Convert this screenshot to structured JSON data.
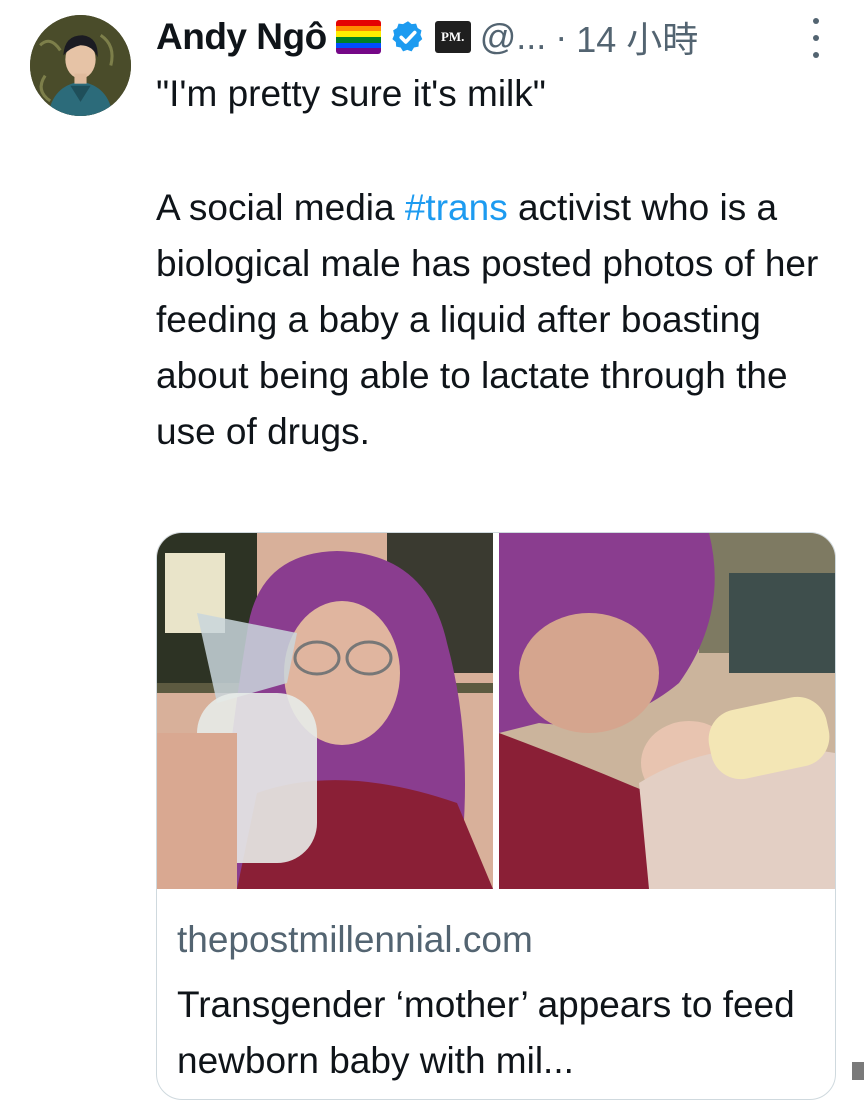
{
  "tweet": {
    "author_name": "Andy Ngô",
    "handle": "@...",
    "separator": "·",
    "time": "14 小時",
    "quote": "\"I'm pretty sure it's milk\"",
    "body_before": "A social media ",
    "hashtag": "#trans",
    "body_after": " activist who is a biological male has posted photos of her feeding a baby a liquid after boasting about being able to lactate through the use of drugs.",
    "badge_logo_text": "PM."
  },
  "icons": {
    "flag": "rainbow-flag-icon",
    "verified": "verified-badge-icon",
    "affiliate": "pm-logo-icon",
    "more": "more-options-icon"
  },
  "link_card": {
    "domain": "thepostmillennial.com",
    "headline": "Transgender ‘mother’ appears to feed newborn baby with mil..."
  },
  "colors": {
    "accent": "#1d9bf0",
    "secondary_text": "#536471",
    "primary_text": "#0f1419",
    "border": "#cfd9de"
  }
}
